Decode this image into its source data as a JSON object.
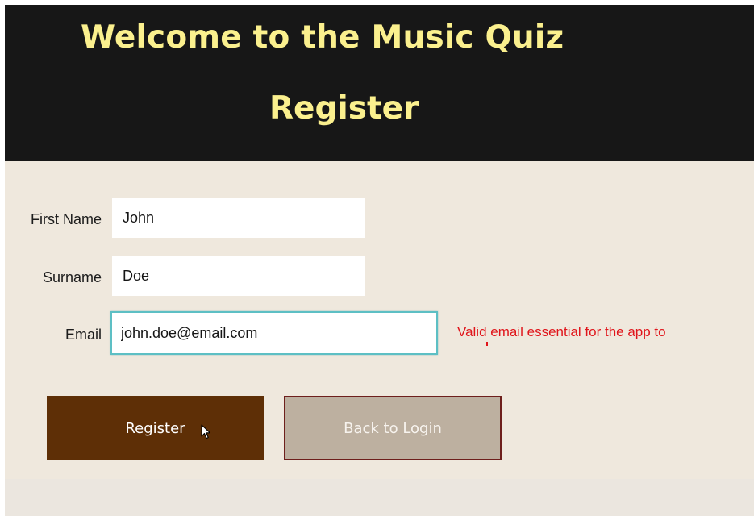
{
  "header": {
    "app_title": "Welcome to the Music Quiz",
    "page_heading": "Register"
  },
  "form": {
    "first_name": {
      "label": "First Name",
      "value": "John"
    },
    "surname": {
      "label": "Surname",
      "value": "Doe"
    },
    "email": {
      "label": "Email",
      "value": "john.doe@email.com",
      "validation_message": "Valid email essential for the app to"
    }
  },
  "actions": {
    "register_label": "Register",
    "back_label": "Back to Login"
  },
  "colors": {
    "header_bg": "#171717",
    "title_text": "#fbf08e",
    "page_bg": "#efe8dd",
    "register_button": "#5e2f06",
    "back_button": "#bdb0a0",
    "back_button_border": "#6e1f1c",
    "validation_text": "#e0151b",
    "focus_ring": "#5dbfc4"
  },
  "icons": {
    "cursor": "mouse-pointer-icon"
  }
}
